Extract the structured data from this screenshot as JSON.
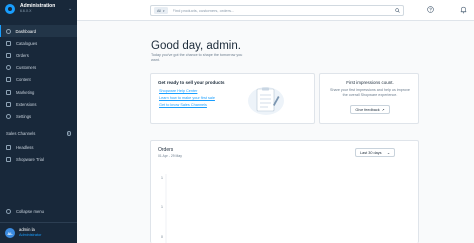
{
  "app": {
    "title": "Administration",
    "subtitle": "6.6.X.X"
  },
  "sidebar": {
    "items": [
      {
        "label": "Dashboard",
        "icon": "dashboard-icon",
        "active": true
      },
      {
        "label": "Catalogues",
        "icon": "catalogues-icon"
      },
      {
        "label": "Orders",
        "icon": "orders-icon"
      },
      {
        "label": "Customers",
        "icon": "customers-icon"
      },
      {
        "label": "Content",
        "icon": "content-icon"
      },
      {
        "label": "Marketing",
        "icon": "marketing-icon"
      },
      {
        "label": "Extensions",
        "icon": "extensions-icon"
      },
      {
        "label": "Settings",
        "icon": "settings-icon"
      }
    ],
    "channels_title": "Sales Channels",
    "channels": [
      {
        "label": "Headless",
        "icon": "headless-icon"
      },
      {
        "label": "Shopware Trial",
        "icon": "storefront-icon"
      }
    ],
    "collapse_label": "Collapse menu",
    "user": {
      "initials": "AL",
      "name": "admin la",
      "role": "Administrator"
    }
  },
  "topbar": {
    "search_type": "All",
    "search_placeholder": "Find products, customers, orders..."
  },
  "main": {
    "greeting": "Good day, admin.",
    "greeting_sub": "Today you've got the chance to shape the tomorrow you want.",
    "setup_card": {
      "title": "Get ready to sell your products",
      "links": [
        "Shopware Help Center",
        "Learn how to make your first sale",
        "Get to know Sales Channels"
      ]
    },
    "impressions_card": {
      "title": "First impressions count.",
      "description": "Share your first impressions and help us improve the overall Shopware experience.",
      "button_label": "Give feedback"
    },
    "orders_card": {
      "title": "Orders",
      "range": "01 Apr - 29 May",
      "period": "Last 30 days",
      "y_ticks": [
        "1",
        "1",
        "0"
      ]
    }
  },
  "colors": {
    "sidebar_bg": "#18283a",
    "accent": "#189eff",
    "page_bg": "#f9fafb"
  }
}
